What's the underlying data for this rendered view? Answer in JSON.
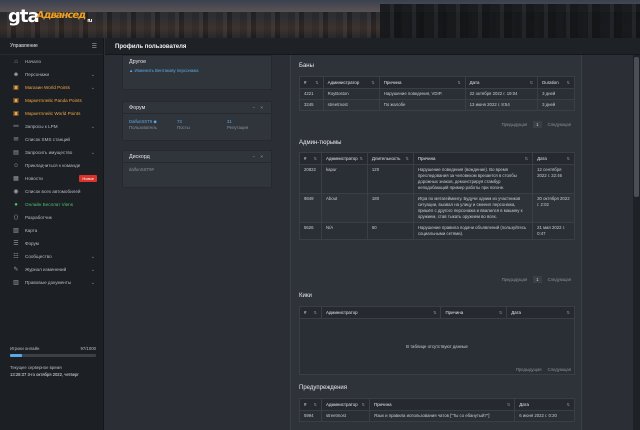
{
  "brand": {
    "logo_main": "gta",
    "logo_script": "Адвансед",
    "logo_small": "ru"
  },
  "topbar": {
    "title": "Профиль пользователя"
  },
  "sidebar": {
    "header": "Управление",
    "items": [
      {
        "label": "Начало",
        "icon": "home-icon",
        "glyph": "⌂",
        "style": "normal",
        "chev": false
      },
      {
        "label": "Персонажи",
        "icon": "user-icon",
        "glyph": "☻",
        "style": "normal",
        "chev": true
      },
      {
        "label": "Магазин World Points",
        "icon": "shop-icon",
        "glyph": "▣",
        "style": "orange",
        "chev": true
      },
      {
        "label": "Маркетплейс Panda Points",
        "icon": "cart-icon",
        "glyph": "▣",
        "style": "orange",
        "chev": false
      },
      {
        "label": "Маркетплейс World Points",
        "icon": "cart-icon",
        "glyph": "▣",
        "style": "orange",
        "chev": false
      },
      {
        "label": "Запросы к LPM",
        "icon": "link-icon",
        "glyph": "⚯",
        "style": "normal",
        "chev": true
      },
      {
        "label": "Список SMS станций",
        "icon": "sms-icon",
        "glyph": "✉",
        "style": "normal",
        "chev": false
      },
      {
        "label": "Запросить имущество",
        "icon": "property-icon",
        "glyph": "▤",
        "style": "normal",
        "chev": true
      },
      {
        "label": "Прикладчиться к команде",
        "icon": "team-icon",
        "glyph": "☺",
        "style": "normal",
        "chev": false
      },
      {
        "label": "Новости",
        "icon": "news-icon",
        "glyph": "▦",
        "style": "normal",
        "chev": false,
        "badge": "Новое"
      },
      {
        "label": "Список всех автомобилей",
        "icon": "car-icon",
        "glyph": "◉",
        "style": "normal",
        "chev": false
      },
      {
        "label": "Онлайн Бесплат Viens",
        "icon": "online-icon",
        "glyph": "●",
        "style": "green",
        "chev": false
      },
      {
        "label": "Разработчик",
        "icon": "code-icon",
        "glyph": "⟨⟩",
        "style": "normal",
        "chev": false
      },
      {
        "label": "Карта",
        "icon": "map-icon",
        "glyph": "▧",
        "style": "normal",
        "chev": false
      },
      {
        "label": "Форум",
        "icon": "forum-icon",
        "glyph": "☰",
        "style": "normal",
        "chev": false
      },
      {
        "label": "Сообщество",
        "icon": "community-icon",
        "glyph": "☷",
        "style": "normal",
        "chev": true
      },
      {
        "label": "Журнал изменений",
        "icon": "log-icon",
        "glyph": "✎",
        "style": "normal",
        "chev": true
      },
      {
        "label": "Правовые документы",
        "icon": "docs-icon",
        "glyph": "▥",
        "style": "normal",
        "chev": true
      }
    ],
    "online_label": "Игроки онлайн",
    "online_value": "97/1000",
    "online_fraction": 0.14,
    "server_time_label": "Текущее серверное время",
    "server_time_value": "13:28:37 3-го октября 2022, четверг"
  },
  "panels": {
    "other": {
      "title": "Другое",
      "link": "Изменить Вентакову персонажа"
    },
    "forum": {
      "title": "Форум",
      "user": "DalfunSST9 ◆",
      "user_sub": "Пользователь",
      "posts": "73",
      "posts_sub": "Посты",
      "rep": "31",
      "rep_sub": "Репутация"
    },
    "discord": {
      "title": "Дискорд",
      "value": "dalfunSST9#"
    }
  },
  "bans": {
    "title": "Баны",
    "headers": [
      "#",
      "Администратор",
      "Причина",
      "Дата",
      "Duration"
    ],
    "rows": [
      [
        "4221",
        "RoyBoston",
        "Нарушение поведения, VDIP.",
        "22 октября 2022 г. 19:04",
        "3 дней"
      ],
      [
        "3245",
        "streetmost",
        "По жалобе",
        "13 июня 2022 г. 8:54",
        "3 дней"
      ]
    ]
  },
  "jail": {
    "title": "Админ-тюрьмы",
    "headers": [
      "#",
      "Администратор",
      "Длительность",
      "Причина",
      "Дата"
    ],
    "rows": [
      [
        "20822",
        "kapur",
        "120",
        "Нарушение поведения (вождение). Во время преследования за человеком врезается в столбы дорожных знаков, демонстрируя стамбур неподобающий пример работы при погоне.",
        "12 сентября 2022 г. 22:46"
      ],
      [
        "9849",
        "About",
        "180",
        "Игра по метагеймингу. Будучи одним из участников ситуации, вызвал на улицу и сменил персонажа, пришёл с другого персонажа и ввалился в машину к оружием, став тыкать оружием во всех.",
        "30 октября 2022 г. 2:02"
      ],
      [
        "5626",
        "N/A",
        "60",
        "Нарушение правила подачи объявлений (пользуйтесь социальными сетями).",
        "21 мая 2022 г. 0:47"
      ]
    ]
  },
  "kicks": {
    "title": "Кики",
    "headers": [
      "#",
      "Администратор",
      "Причина",
      "Дата"
    ],
    "empty": "В таблице отсутствуют данные"
  },
  "warnings": {
    "title": "Предупреждения",
    "headers": [
      "#",
      "Администратор",
      "Причина",
      "Дата"
    ],
    "rows": [
      [
        "5994",
        "streetmost",
        "Язык и правила использования чатов [\"Ты со ебанутый?\"]",
        "6 июня 2022 г. 0:20"
      ]
    ]
  },
  "pager": {
    "prev": "Предыдущая",
    "page": "1",
    "next": "Следующая"
  },
  "controls": {
    "collapse": "−",
    "close": "×"
  }
}
